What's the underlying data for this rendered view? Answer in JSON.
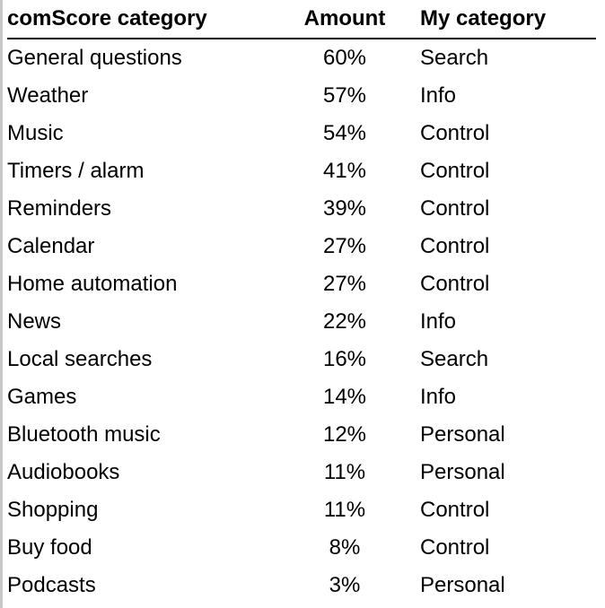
{
  "table": {
    "headers": [
      "comScore category",
      "Amount",
      "My category"
    ],
    "rows": [
      {
        "category": "General questions",
        "amount": "60%",
        "my_category": "Search"
      },
      {
        "category": "Weather",
        "amount": "57%",
        "my_category": "Info"
      },
      {
        "category": "Music",
        "amount": "54%",
        "my_category": "Control"
      },
      {
        "category": "Timers / alarm",
        "amount": "41%",
        "my_category": "Control"
      },
      {
        "category": "Reminders",
        "amount": "39%",
        "my_category": "Control"
      },
      {
        "category": "Calendar",
        "amount": "27%",
        "my_category": "Control"
      },
      {
        "category": "Home automation",
        "amount": "27%",
        "my_category": "Control"
      },
      {
        "category": "News",
        "amount": "22%",
        "my_category": "Info"
      },
      {
        "category": "Local searches",
        "amount": "16%",
        "my_category": "Search"
      },
      {
        "category": "Games",
        "amount": "14%",
        "my_category": "Info"
      },
      {
        "category": "Bluetooth music",
        "amount": "12%",
        "my_category": "Personal"
      },
      {
        "category": "Audiobooks",
        "amount": "11%",
        "my_category": "Personal"
      },
      {
        "category": "Shopping",
        "amount": "11%",
        "my_category": "Control"
      },
      {
        "category": "Buy food",
        "amount": "8%",
        "my_category": "Control"
      },
      {
        "category": "Podcasts",
        "amount": "3%",
        "my_category": "Personal"
      }
    ]
  }
}
